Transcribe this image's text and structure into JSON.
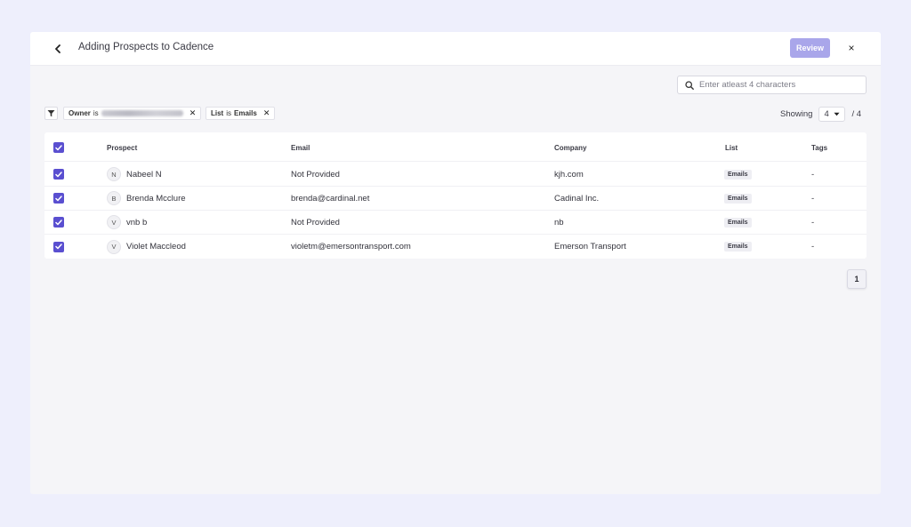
{
  "header": {
    "title": "Adding Prospects to Cadence",
    "review_label": "Review",
    "close_label": "×"
  },
  "search": {
    "placeholder": "Enter atleast 4 characters"
  },
  "filters": [
    {
      "key": "Owner",
      "op": "is",
      "value": ""
    },
    {
      "key": "List",
      "op": "is",
      "value": "Emails"
    }
  ],
  "showing": {
    "label": "Showing",
    "value": "4",
    "total": "/ 4"
  },
  "table": {
    "columns": [
      "Prospect",
      "Email",
      "Company",
      "List",
      "Tags"
    ],
    "rows": [
      {
        "initial": "N",
        "name": "Nabeel N",
        "email": "Not Provided",
        "company": "kjh.com",
        "list": "Emails",
        "tags": "-"
      },
      {
        "initial": "B",
        "name": "Brenda Mcclure",
        "email": "brenda@cardinal.net",
        "company": "Cadinal Inc.",
        "list": "Emails",
        "tags": "-"
      },
      {
        "initial": "V",
        "name": "vnb b",
        "email": "Not Provided",
        "company": "nb",
        "list": "Emails",
        "tags": "-"
      },
      {
        "initial": "V",
        "name": "Violet Maccleod",
        "email": "violetm@emersontransport.com",
        "company": "Emerson Transport",
        "list": "Emails",
        "tags": "-"
      }
    ]
  },
  "pagination": {
    "current": "1"
  },
  "colors": {
    "accent": "#5a4fd0",
    "review_button": "#a9a6ea",
    "backdrop": "#eeeffc"
  },
  "icons": {
    "back": "chevron-left-icon",
    "close": "close-icon",
    "search": "search-icon",
    "filter": "filter-icon",
    "dropdown": "caret-down-icon",
    "checkbox": "checkmark-icon"
  }
}
